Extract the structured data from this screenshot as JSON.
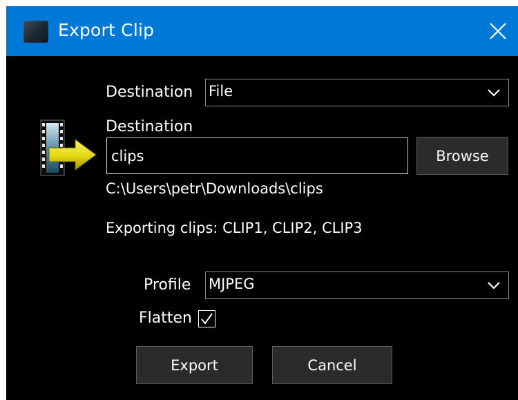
{
  "window": {
    "title": "Export Clip",
    "close_icon": "close-icon",
    "app_icon": "app-icon"
  },
  "destination_type": {
    "label": "Destination",
    "value": "File"
  },
  "destination_path": {
    "label": "Destination",
    "value": "clips",
    "browse_label": "Browse",
    "resolved_path": "C:\\Users\\petr\\Downloads\\clips"
  },
  "exporting_info": "Exporting clips: CLIP1, CLIP2, CLIP3",
  "profile": {
    "label": "Profile",
    "value": "MJPEG"
  },
  "flatten": {
    "label": "Flatten",
    "checked": true
  },
  "actions": {
    "export_label": "Export",
    "cancel_label": "Cancel"
  },
  "colors": {
    "titlebar": "#0078d7",
    "background": "#000000",
    "button": "#2b2b2b",
    "arrow": "#e8e020"
  }
}
